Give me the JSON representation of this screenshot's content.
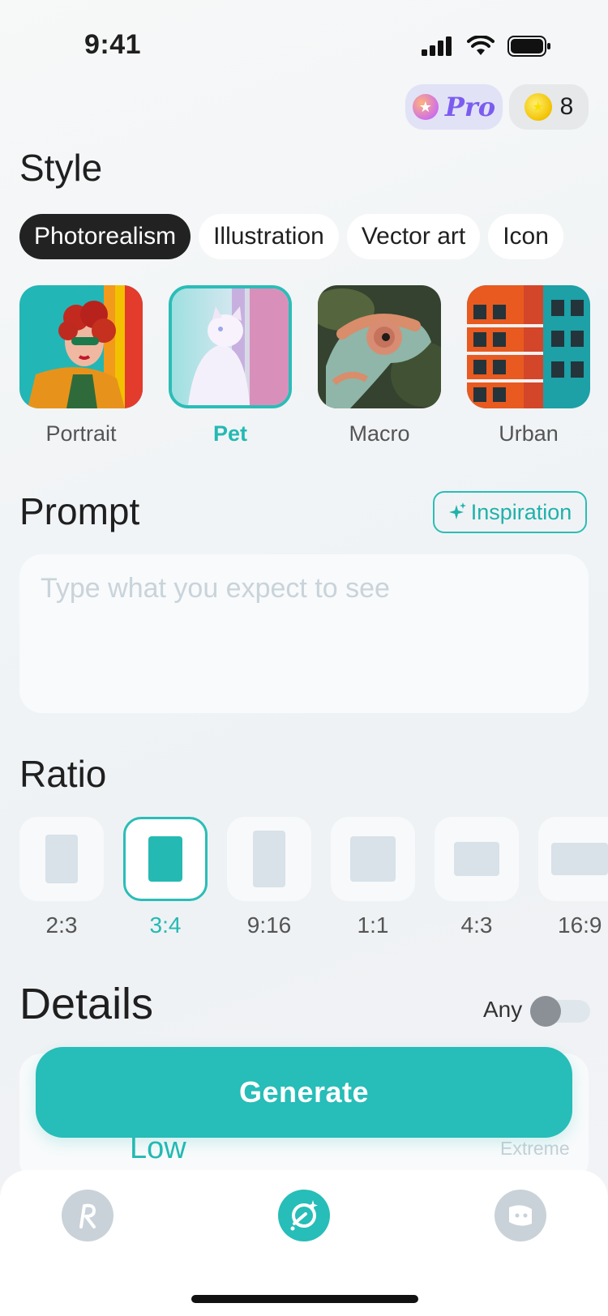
{
  "status": {
    "time": "9:41"
  },
  "header": {
    "pro_label": "Pro",
    "coins": "8"
  },
  "style_section": {
    "title": "Style",
    "tabs": [
      {
        "label": "Photorealism",
        "active": true
      },
      {
        "label": "Illustration",
        "active": false
      },
      {
        "label": "Vector art",
        "active": false
      },
      {
        "label": "Icon",
        "active": false
      }
    ],
    "cards": [
      {
        "label": "Portrait",
        "selected": false
      },
      {
        "label": "Pet",
        "selected": true
      },
      {
        "label": "Macro",
        "selected": false
      },
      {
        "label": "Urban",
        "selected": false
      }
    ]
  },
  "prompt_section": {
    "title": "Prompt",
    "inspiration_label": "Inspiration",
    "placeholder": "Type what you expect to see",
    "value": ""
  },
  "ratio_section": {
    "title": "Ratio",
    "options": [
      {
        "label": "2:3",
        "selected": false
      },
      {
        "label": "3:4",
        "selected": true
      },
      {
        "label": "9:16",
        "selected": false
      },
      {
        "label": "1:1",
        "selected": false
      },
      {
        "label": "4:3",
        "selected": false
      },
      {
        "label": "16:9",
        "selected": false
      }
    ]
  },
  "details_section": {
    "title": "Details",
    "any_label": "Any",
    "level_low": "Low",
    "level_extreme": "Extreme"
  },
  "generate_label": "Generate",
  "colors": {
    "accent": "#27bdb8",
    "tab_active": "#222222"
  },
  "nav": {
    "items": [
      "r-logo-icon",
      "create-icon",
      "profile-face-icon"
    ]
  }
}
